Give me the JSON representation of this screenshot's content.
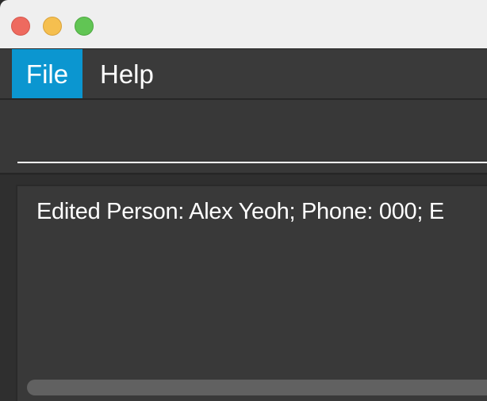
{
  "menu": {
    "file_label": "File",
    "help_label": "Help"
  },
  "command_box": {
    "value": "",
    "placeholder": ""
  },
  "result_display": {
    "text": "Edited Person: Alex Yeoh; Phone: 000; E"
  },
  "colors": {
    "menu_selected": "#0b96d0",
    "background": "#383838",
    "close_button": "#ee6a5f",
    "minimize_button": "#f5bf4f",
    "maximize_button": "#61c554"
  }
}
